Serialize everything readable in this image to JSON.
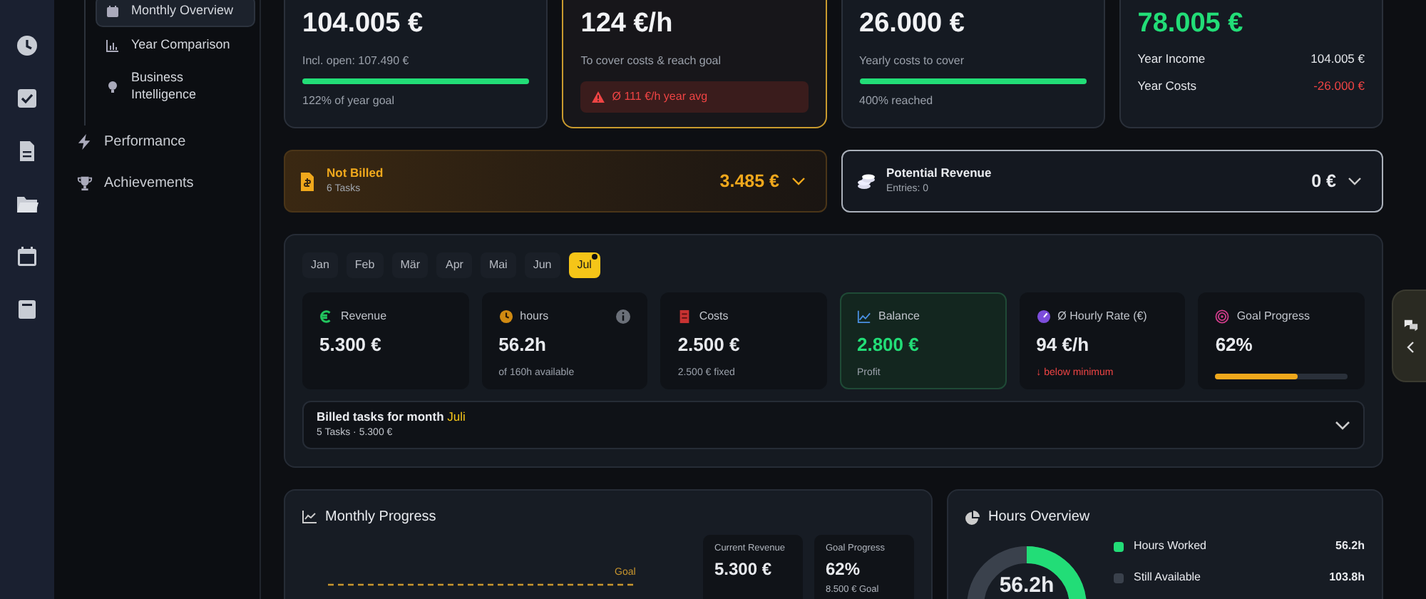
{
  "sidebar": {
    "subitems": [
      {
        "label": "Monthly Overview",
        "selected": true
      },
      {
        "label": "Year Comparison",
        "selected": false
      },
      {
        "label": "Business Intelligence",
        "selected": false
      }
    ],
    "items": [
      {
        "label": "Performance"
      },
      {
        "label": "Achievements"
      }
    ]
  },
  "summary_cards": [
    {
      "kind": "progress",
      "value": "104.005 €",
      "positive": false,
      "highlighted": false,
      "note": "Incl. open: 107.490 €",
      "level": 1.0,
      "footer": "122% of year goal"
    },
    {
      "kind": "alert",
      "value": "124 €/h",
      "positive": false,
      "highlighted": true,
      "note": "To cover costs & reach goal",
      "alert": "Ø 111 €/h year avg"
    },
    {
      "kind": "progress",
      "value": "26.000 €",
      "positive": false,
      "highlighted": false,
      "note": "Yearly costs to cover",
      "level": 1.0,
      "footer": "400% reached"
    },
    {
      "kind": "lines",
      "value": "78.005 €",
      "positive": true,
      "highlighted": false,
      "rows": [
        {
          "label": "Year Income",
          "value": "104.005 €",
          "negative": false
        },
        {
          "label": "Year Costs",
          "value": "-26.000 €",
          "negative": true
        }
      ]
    }
  ],
  "not_billed": {
    "title": "Not Billed",
    "subtitle": "6 Tasks",
    "amount": "3.485 €"
  },
  "potential_revenue": {
    "title": "Potential Revenue",
    "subtitle": "Entries: 0",
    "amount": "0 €"
  },
  "months": [
    {
      "label": "Jan",
      "selected": false,
      "dot": false
    },
    {
      "label": "Feb",
      "selected": false,
      "dot": false
    },
    {
      "label": "Mär",
      "selected": false,
      "dot": false
    },
    {
      "label": "Apr",
      "selected": false,
      "dot": false
    },
    {
      "label": "Mai",
      "selected": false,
      "dot": false
    },
    {
      "label": "Jun",
      "selected": false,
      "dot": false
    },
    {
      "label": "Jul",
      "selected": true,
      "dot": true
    }
  ],
  "kpis": [
    {
      "label": "Revenue",
      "value": "5.300 €",
      "positive": false,
      "highlighted": false,
      "info": false
    },
    {
      "label": "hours",
      "value": "56.2h",
      "positive": false,
      "highlighted": false,
      "info": true,
      "note": "of 160h available",
      "note_negative": false
    },
    {
      "label": "Costs",
      "value": "2.500 €",
      "positive": false,
      "highlighted": false,
      "info": false,
      "note": "2.500 € fixed",
      "note_negative": false
    },
    {
      "label": "Balance",
      "value": "2.800 €",
      "positive": true,
      "highlighted": true,
      "info": false,
      "note": "Profit",
      "note_negative": false
    },
    {
      "label": "Ø Hourly Rate (€)",
      "value": "94 €/h",
      "positive": false,
      "highlighted": false,
      "info": false,
      "note": "↓ below minimum",
      "note_negative": true
    },
    {
      "label": "Goal Progress",
      "value": "62%",
      "positive": false,
      "highlighted": false,
      "info": false,
      "level": 0.62
    }
  ],
  "billed_tasks": {
    "title": "Billed tasks for month",
    "month": "Juli",
    "summary": "5 Tasks · 5.300 €"
  },
  "monthly_progress": {
    "title": "Monthly Progress",
    "goal_label": "Goal",
    "stats": [
      {
        "label": "Current Revenue",
        "value": "5.300 €"
      },
      {
        "label": "Goal Progress",
        "value": "62%",
        "note": "8.500 € Goal"
      }
    ]
  },
  "hours_overview": {
    "title": "Hours Overview",
    "center": "56.2h",
    "legend": [
      {
        "label": "Hours Worked",
        "value": "56.2h",
        "color": "#22dd77"
      },
      {
        "label": "Still Available",
        "value": "103.8h",
        "color": "#3a414c"
      }
    ]
  }
}
